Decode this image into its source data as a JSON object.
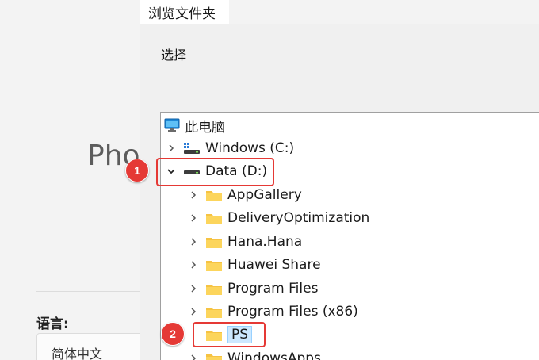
{
  "background_window": {
    "title": "Pho",
    "language_label": "语言:",
    "language_value": "简体中文"
  },
  "dialog": {
    "title": "浏览文件夹",
    "prompt": "选择"
  },
  "tree": {
    "root": {
      "label": "此电脑",
      "icon": "computer-icon"
    },
    "drives": [
      {
        "label": "Windows (C:)",
        "icon": "windows-drive-icon",
        "expanded": false
      },
      {
        "label": "Data (D:)",
        "icon": "drive-icon",
        "expanded": true
      }
    ],
    "folders": [
      {
        "label": "AppGallery"
      },
      {
        "label": "DeliveryOptimization"
      },
      {
        "label": "Hana.Hana"
      },
      {
        "label": "Huawei Share"
      },
      {
        "label": "Program Files"
      },
      {
        "label": "Program Files (x86)"
      },
      {
        "label": "PS",
        "selected": true
      },
      {
        "label": "WindowsApps"
      }
    ]
  },
  "annotations": [
    {
      "number": "1",
      "target": "Data (D:)"
    },
    {
      "number": "2",
      "target": "PS"
    }
  ],
  "colors": {
    "annotation": "#e53935",
    "selection": "#cce8ff",
    "folder": "#f6c343"
  }
}
